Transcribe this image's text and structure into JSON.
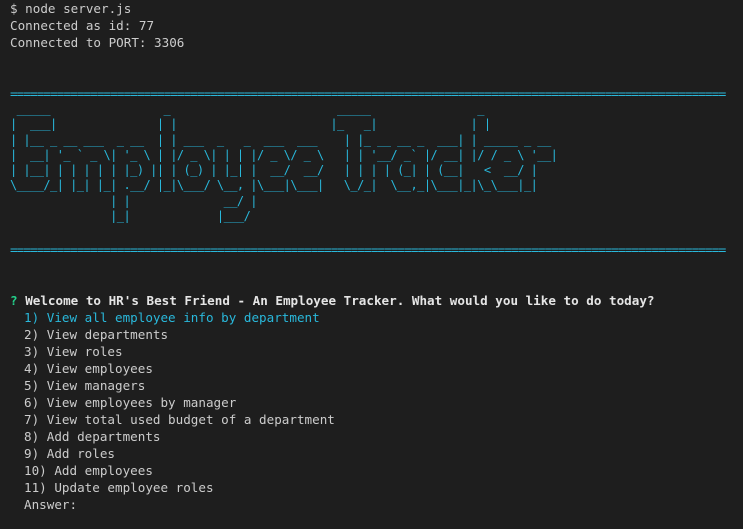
{
  "terminal": {
    "command_line": "$ node server.js",
    "status_lines": [
      "Connected as id: 77",
      "Connected to PORT: 3306"
    ],
    "rule": "==================================================================================================================",
    "banner_art": " _____                 _                         _____                _             \n|  ___|               | |                       |_   _|              | |            \n| |__ _ __ ___  _ __  | | ___  _   _  ___  ___    | |_ __ __ _  ___| | _____ _ __ \n|  __| '_ ` _ \\| '_ \\ | |/ _ \\| | | |/ _ \\/ _ \\   | | '__/ _` |/ __| |/ / _ \\ '__|\n| |__| | | | | | |_) || | (_) | |_| |  __/  __/   | | | | (_| | (__|   <  __/ |   \n\\____/_| |_| |_| .__/ |_|\\___/ \\__, |\\___|\\___|   \\_/_|  \\__,_|\\___|_|\\_\\___|_|   \n               | |              __/ |                                            \n               |_|             |___/                                             ",
    "prompt_marker": "?",
    "question": "Welcome to HR's Best Friend - An Employee Tracker. What would you like to do today?",
    "choices": [
      "1) View all employee info by department",
      "2) View departments",
      "3) View roles",
      "4) View employees",
      "5) View managers",
      "6) View employees by manager",
      "7) View total used budget of a department",
      "8) Add departments",
      "9) Add roles",
      "10) Add employees",
      "11) Update employee roles"
    ],
    "selected_index": 0,
    "answer_label": "Answer:",
    "colors": {
      "background": "#1e1e1e",
      "text": "#cccccc",
      "accent_cyan": "#29b8db",
      "prompt_green": "#23d18b"
    }
  }
}
